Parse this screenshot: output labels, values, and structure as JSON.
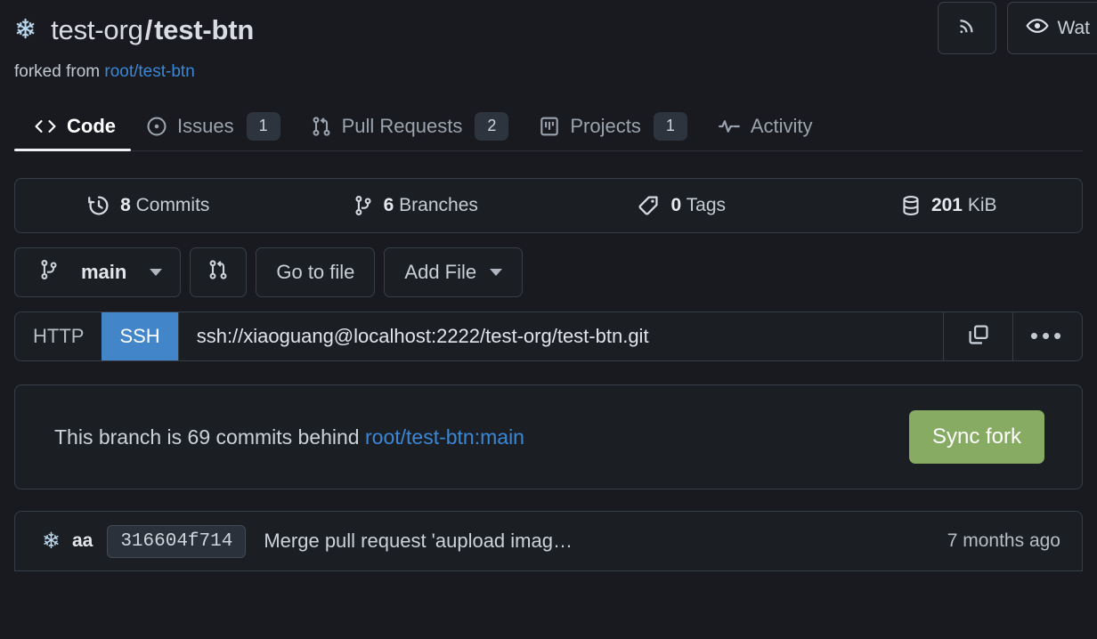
{
  "header": {
    "avatar_icon": "snowflake-icon",
    "owner": "test-org",
    "separator": "/",
    "repo": "test-btn",
    "rss_icon": "rss-icon",
    "watch_icon": "eye-icon",
    "watch_label": "Wat"
  },
  "fork_notice": {
    "prefix": "forked from",
    "source": "root/test-btn"
  },
  "tabs": [
    {
      "label": "Code",
      "icon": "code-icon",
      "active": true,
      "badge": ""
    },
    {
      "label": "Issues",
      "icon": "issue-opened-icon",
      "active": false,
      "badge": "1"
    },
    {
      "label": "Pull Requests",
      "icon": "git-pull-request-icon",
      "active": false,
      "badge": "2"
    },
    {
      "label": "Projects",
      "icon": "project-board-icon",
      "active": false,
      "badge": "1"
    },
    {
      "label": "Activity",
      "icon": "pulse-icon",
      "active": false,
      "badge": ""
    }
  ],
  "stats": [
    {
      "icon": "history-clock-icon",
      "value": "8",
      "label": "Commits"
    },
    {
      "icon": "git-branch-icon",
      "value": "6",
      "label": "Branches"
    },
    {
      "icon": "tag-icon",
      "value": "0",
      "label": "Tags"
    },
    {
      "icon": "database-icon",
      "value": "201",
      "label": "KiB"
    }
  ],
  "toolbar": {
    "branch_icon": "git-branch-icon",
    "branch_name": "main",
    "pull_request_icon": "git-pull-request-icon",
    "go_to_file_label": "Go to file",
    "add_file_label": "Add File"
  },
  "clone": {
    "http_label": "HTTP",
    "ssh_label": "SSH",
    "active_protocol": "SSH",
    "url": "ssh://xiaoguang@localhost:2222/test-org/test-btn.git",
    "copy_icon": "copy-icon",
    "more_icon": "ellipsis-icon",
    "more_label": "•••"
  },
  "sync_fork": {
    "message_prefix": "This branch is 69 commits behind",
    "upstream": "root/test-btn:main",
    "button_label": "Sync fork"
  },
  "latest_commit": {
    "avatar_icon": "snowflake-icon",
    "author": "aa",
    "sha": "316604f714",
    "message": "Merge pull request 'aupload imag…",
    "time": "7 months ago"
  },
  "colors": {
    "page_bg": "#181a1f",
    "panel_bg": "#1b1f24",
    "border": "#373e47",
    "link": "#3b87d6",
    "accent_blue": "#4285c8",
    "accent_green": "#87ab63",
    "badge_bg": "#2e343d"
  }
}
